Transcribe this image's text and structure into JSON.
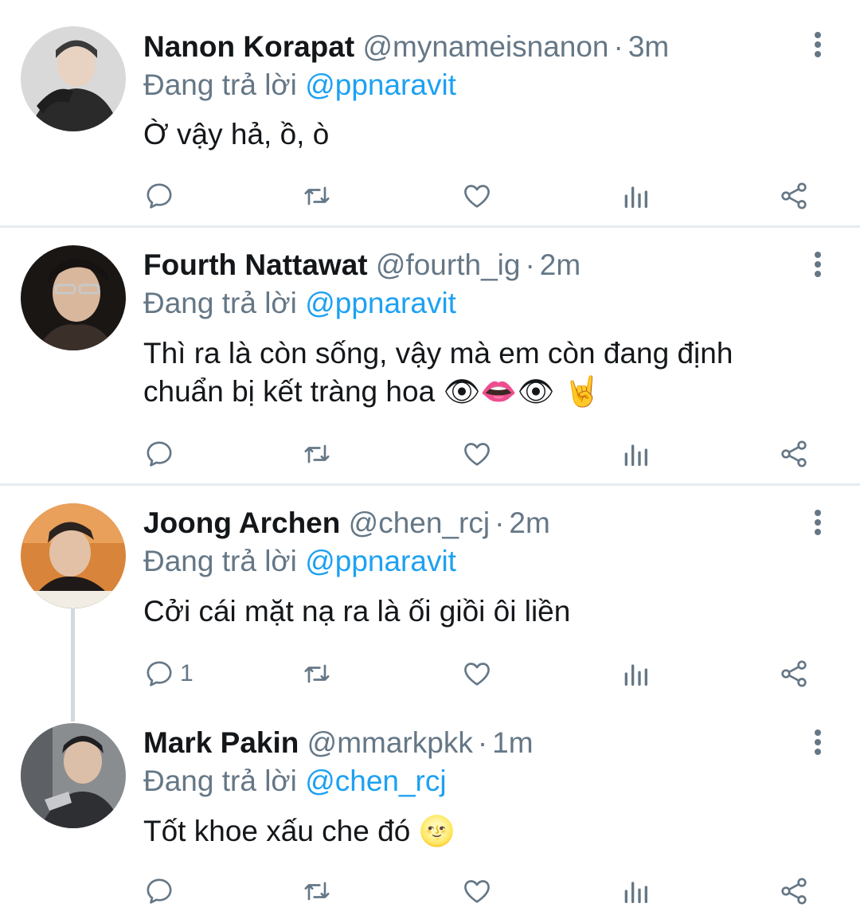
{
  "reply_prefix": "Đang trả lời",
  "tweets": [
    {
      "name": "Nanon Korapat",
      "handle": "@mynameisnanon",
      "sep": "·",
      "time": "3m",
      "reply_to": "@ppnaravit",
      "text": "Ờ vậy hả, ồ, ò",
      "emoji": "",
      "reply_count": "",
      "avatar_colors": [
        "#d9d9d9",
        "#2a2a2a"
      ]
    },
    {
      "name": "Fourth Nattawat",
      "handle": "@fourth_ig",
      "sep": "·",
      "time": "2m",
      "reply_to": "@ppnaravit",
      "text": "Thì ra là còn sống, vậy mà em còn đang định chuẩn bị kết tràng hoa",
      "emoji": "👁👄👁 🤘",
      "reply_count": "",
      "avatar_colors": [
        "#3b2f2a",
        "#1a1614"
      ]
    },
    {
      "name": "Joong Archen",
      "handle": "@chen_rcj",
      "sep": "·",
      "time": "2m",
      "reply_to": "@ppnaravit",
      "text": "Cởi cái mặt nạ ra là ối giồi ôi liền",
      "emoji": "",
      "reply_count": "1",
      "avatar_colors": [
        "#d8843a",
        "#2b2320"
      ]
    },
    {
      "name": "Mark Pakin",
      "handle": "@mmarkpkk",
      "sep": "·",
      "time": "1m",
      "reply_to": "@chen_rcj",
      "text": "Tốt khoe xấu che đó",
      "emoji": "🌝",
      "reply_count": "",
      "avatar_colors": [
        "#8a8d90",
        "#2d2f33"
      ]
    }
  ],
  "icons": {
    "reply": "reply-icon",
    "retweet": "retweet-icon",
    "like": "heart-icon",
    "stats": "analytics-icon",
    "share": "share-icon",
    "more": "more-vertical-icon"
  },
  "colors": {
    "link": "#1da1f2",
    "muted": "#657786",
    "text": "#14171a",
    "divider": "#e6ecf0"
  }
}
